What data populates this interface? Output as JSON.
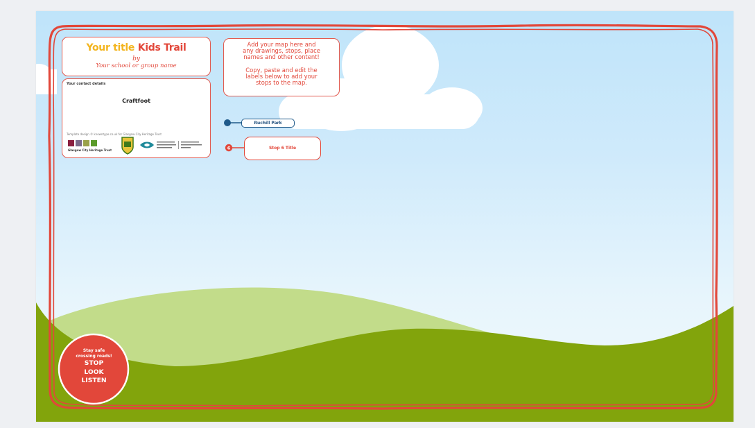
{
  "title_card": {
    "title_part_1": "Your title",
    "title_part_2": " Kids Trail",
    "by": "by",
    "school": "Your school or group name"
  },
  "contact_card": {
    "label": "Your contact details",
    "name": "Craftfoot",
    "template_credit": "Template design © knowntype.co.uk for Glasgow City Heritage Trust",
    "logo_text": "Glasgow City Heritage Trust"
  },
  "info_card": {
    "lines_1": [
      "Add your map here and",
      "any drawings, stops, place",
      "names and other content!"
    ],
    "lines_2": [
      "Copy, paste and edit the",
      "labels below to add your",
      "stops to the map."
    ]
  },
  "stops": [
    {
      "label": "Ruchill Park",
      "number": ""
    },
    {
      "label": "Stop 6 Title",
      "number": "6"
    }
  ],
  "safety_badge": {
    "line_1": "Stay safe",
    "line_2": "crossing roads!",
    "word_1": "STOP",
    "word_2": "LOOK",
    "word_3": "LISTEN"
  },
  "colors": {
    "border_red": "#e2473a",
    "title_yellow": "#f3b51f",
    "stop_blue": "#1f5a8a",
    "hill_dark": "#82a40c",
    "hill_light": "#c2dc8a",
    "sky_top": "#bfe4fa"
  }
}
